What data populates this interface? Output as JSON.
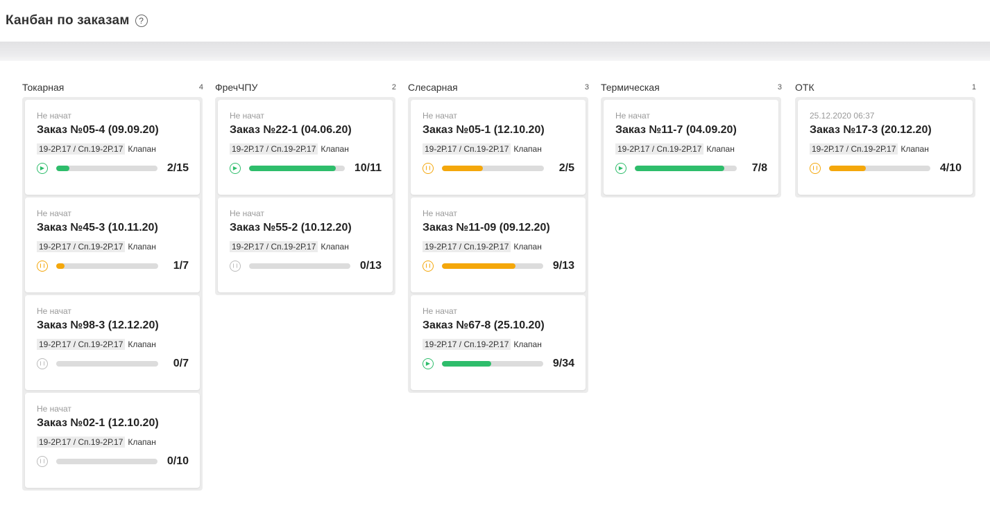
{
  "header": {
    "title": "Канбан по заказам",
    "help_icon": "question-circle-icon"
  },
  "colors": {
    "green": "#2ebd6b",
    "orange": "#f4a70b",
    "grey": "#bbbbbb"
  },
  "columns": [
    {
      "name": "Токарная",
      "count": "4",
      "cards": [
        {
          "status": "Не начат",
          "order": "Заказ №05-4 (09.09.20)",
          "code": "19-2Р.17 / Сп.19-2Р.17",
          "item": "Клапан",
          "state": "run",
          "progress": "2/15",
          "fraction": 0.13
        },
        {
          "status": "Не начат",
          "order": "Заказ №45-3 (10.11.20)",
          "code": "19-2Р.17 / Сп.19-2Р.17",
          "item": "Клапан",
          "state": "pause",
          "progress": "1/7",
          "fraction": 0.08
        },
        {
          "status": "Не начат",
          "order": "Заказ №98-3 (12.12.20)",
          "code": "19-2Р.17 / Сп.19-2Р.17",
          "item": "Клапан",
          "state": "idle",
          "progress": "0/7",
          "fraction": 0
        },
        {
          "status": "Не начат",
          "order": "Заказ №02-1 (12.10.20)",
          "code": "19-2Р.17 / Сп.19-2Р.17",
          "item": "Клапан",
          "state": "idle",
          "progress": "0/10",
          "fraction": 0
        }
      ]
    },
    {
      "name": "ФречЧПУ",
      "count": "2",
      "cards": [
        {
          "status": "Не начат",
          "order": "Заказ №22-1 (04.06.20)",
          "code": "19-2Р.17 / Сп.19-2Р.17",
          "item": "Клапан",
          "state": "run",
          "progress": "10/11",
          "fraction": 0.91
        },
        {
          "status": "Не начат",
          "order": "Заказ №55-2 (10.12.20)",
          "code": "19-2Р.17 / Сп.19-2Р.17",
          "item": "Клапан",
          "state": "idle",
          "progress": "0/13",
          "fraction": 0
        }
      ]
    },
    {
      "name": "Слесарная",
      "count": "3",
      "cards": [
        {
          "status": "Не начат",
          "order": "Заказ №05-1 (12.10.20)",
          "code": "19-2Р.17 / Сп.19-2Р.17",
          "item": "Клапан",
          "state": "pause",
          "progress": "2/5",
          "fraction": 0.4
        },
        {
          "status": "Не начат",
          "order": "Заказ №11-09 (09.12.20)",
          "code": "19-2Р.17 / Сп.19-2Р.17",
          "item": "Клапан",
          "state": "pause",
          "progress": "9/13",
          "fraction": 0.73
        },
        {
          "status": "Не начат",
          "order": "Заказ №67-8 (25.10.20)",
          "code": "19-2Р.17 / Сп.19-2Р.17",
          "item": "Клапан",
          "state": "run",
          "progress": "9/34",
          "fraction": 0.49
        }
      ]
    },
    {
      "name": "Термическая",
      "count": "3",
      "cards": [
        {
          "status": "Не начат",
          "order": "Заказ №11-7 (04.09.20)",
          "code": "19-2Р.17 / Сп.19-2Р.17",
          "item": "Клапан",
          "state": "run",
          "progress": "7/8",
          "fraction": 0.88
        }
      ]
    },
    {
      "name": "ОТК",
      "count": "1",
      "cards": [
        {
          "status": "25.12.2020 06:37",
          "order": "Заказ №17-3 (20.12.20)",
          "code": "19-2Р.17 / Сп.19-2Р.17",
          "item": "Клапан",
          "state": "pause",
          "progress": "4/10",
          "fraction": 0.36
        }
      ]
    }
  ]
}
